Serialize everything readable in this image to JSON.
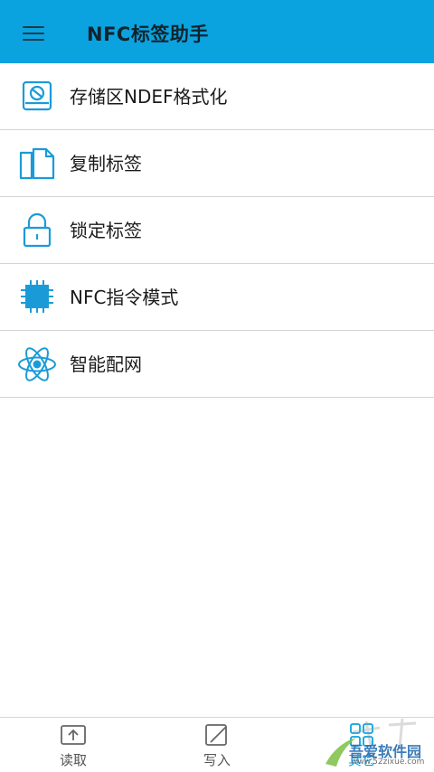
{
  "app": {
    "title": "NFC标签助手",
    "accent_color": "#0aa3e0"
  },
  "menu": {
    "items": [
      {
        "label": "存储区NDEF格式化",
        "icon": "storage-format-icon"
      },
      {
        "label": "复制标签",
        "icon": "copy-icon"
      },
      {
        "label": "锁定标签",
        "icon": "lock-icon"
      },
      {
        "label": "NFC指令模式",
        "icon": "chip-icon"
      },
      {
        "label": "智能配网",
        "icon": "atom-network-icon"
      }
    ]
  },
  "bottom_nav": {
    "tabs": [
      {
        "label": "读取",
        "icon": "read-icon"
      },
      {
        "label": "写入",
        "icon": "write-icon"
      },
      {
        "label": "其它",
        "icon": "grid-icon",
        "active": true
      }
    ]
  },
  "watermark": {
    "text": "吾爱软件园",
    "url": "www.52zixue.com"
  }
}
